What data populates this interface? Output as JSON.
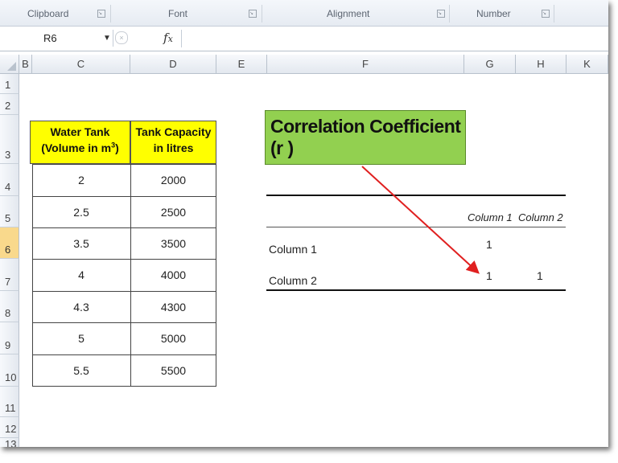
{
  "ribbon": {
    "groups": [
      {
        "label": "Clipboard"
      },
      {
        "label": "Font"
      },
      {
        "label": "Alignment"
      },
      {
        "label": "Number"
      }
    ]
  },
  "formula_bar": {
    "name_box": "R6",
    "fx": "fx",
    "formula": ""
  },
  "columns": [
    "B",
    "C",
    "D",
    "E",
    "F",
    "G",
    "H",
    "K"
  ],
  "rows": [
    "1",
    "2",
    "3",
    "4",
    "5",
    "6",
    "7",
    "8",
    "9",
    "10",
    "11",
    "12",
    "13"
  ],
  "active_row": "6",
  "table": {
    "header_c_line1": "Water Tank",
    "header_c_line2": "(Volume in m",
    "header_c_sup": "3",
    "header_c_close": ")",
    "header_d_line1": "Tank Capacity",
    "header_d_line2": "in litres",
    "volume": [
      "2",
      "2.5",
      "3.5",
      "4",
      "4.3",
      "5",
      "5.5"
    ],
    "capacity": [
      "2000",
      "2500",
      "3500",
      "4000",
      "4300",
      "5000",
      "5500"
    ],
    "header_fill": "#ffff00"
  },
  "correlation": {
    "title": "Correlation Coefficient (r )",
    "title_fill": "#92d050",
    "col_headers": [
      "Column 1",
      "Column 2"
    ],
    "row_labels": [
      "Column 1",
      "Column 2"
    ],
    "r11": "1",
    "r21": "1",
    "r22": "1",
    "arrow_color": "#e02020"
  }
}
